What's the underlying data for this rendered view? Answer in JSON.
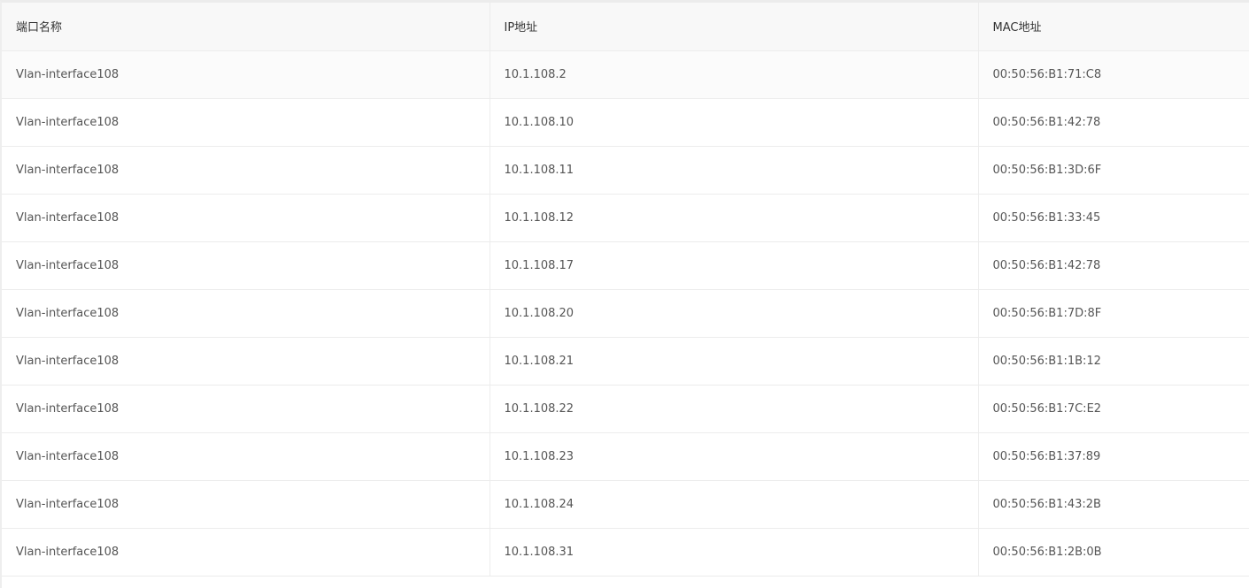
{
  "table": {
    "headers": [
      "端口名称",
      "IP地址",
      "MAC地址"
    ],
    "rows": [
      [
        "Vlan-interface108",
        "10.1.108.2",
        "00:50:56:B1:71:C8"
      ],
      [
        "Vlan-interface108",
        "10.1.108.10",
        "00:50:56:B1:42:78"
      ],
      [
        "Vlan-interface108",
        "10.1.108.11",
        "00:50:56:B1:3D:6F"
      ],
      [
        "Vlan-interface108",
        "10.1.108.12",
        "00:50:56:B1:33:45"
      ],
      [
        "Vlan-interface108",
        "10.1.108.17",
        "00:50:56:B1:42:78"
      ],
      [
        "Vlan-interface108",
        "10.1.108.20",
        "00:50:56:B1:7D:8F"
      ],
      [
        "Vlan-interface108",
        "10.1.108.21",
        "00:50:56:B1:1B:12"
      ],
      [
        "Vlan-interface108",
        "10.1.108.22",
        "00:50:56:B1:7C:E2"
      ],
      [
        "Vlan-interface108",
        "10.1.108.23",
        "00:50:56:B1:37:89"
      ],
      [
        "Vlan-interface108",
        "10.1.108.24",
        "00:50:56:B1:43:2B"
      ],
      [
        "Vlan-interface108",
        "10.1.108.31",
        "00:50:56:B1:2B:0B"
      ]
    ]
  }
}
